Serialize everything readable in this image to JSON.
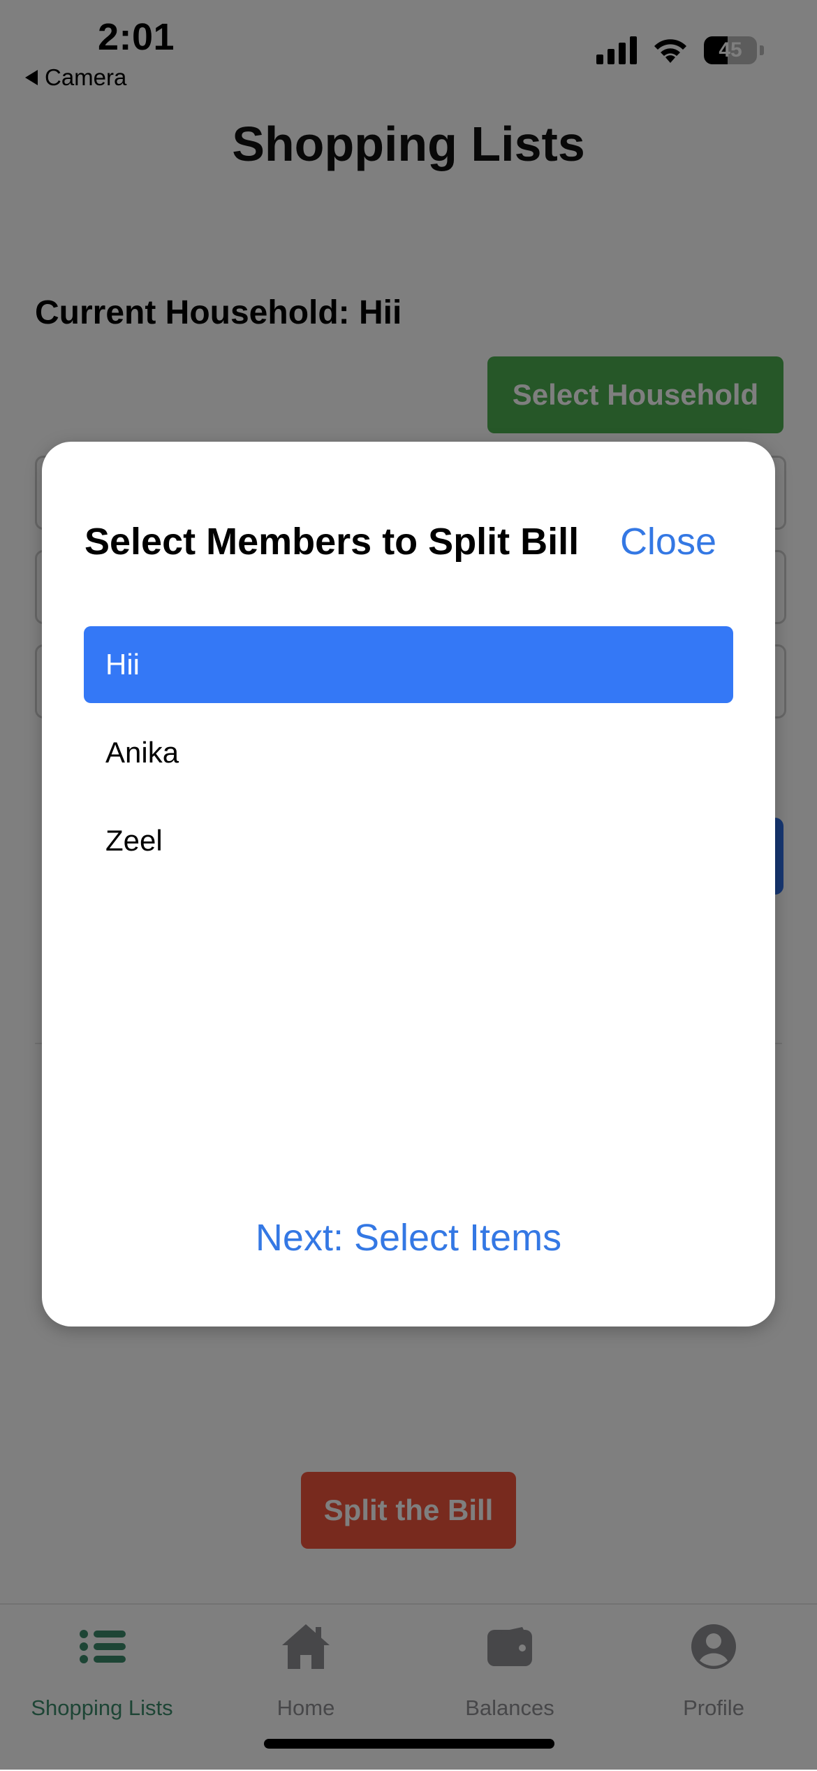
{
  "status_bar": {
    "time": "2:01",
    "back_label": "Camera",
    "battery": "45",
    "battery_level": 0.45
  },
  "page": {
    "title": "Shopping Lists",
    "current_household": "Current Household: Hii",
    "select_household_label": "Select Household",
    "split_bill_label": "Split the Bill"
  },
  "modal": {
    "title": "Select Members to Split Bill",
    "close_label": "Close",
    "members": [
      {
        "name": "Hii",
        "selected": true
      },
      {
        "name": "Anika",
        "selected": false
      },
      {
        "name": "Zeel",
        "selected": false
      }
    ],
    "next_label": "Next: Select Items"
  },
  "tab_bar": {
    "tabs": [
      {
        "label": "Shopping Lists",
        "icon": "list-icon",
        "active": true
      },
      {
        "label": "Home",
        "icon": "home-icon",
        "active": false
      },
      {
        "label": "Balances",
        "icon": "wallet-icon",
        "active": false
      },
      {
        "label": "Profile",
        "icon": "profile-icon",
        "active": false
      }
    ]
  },
  "colors": {
    "accent_blue": "#3478f6",
    "link_blue": "#3478e4",
    "green_button": "#4caf50",
    "red_button": "#f0553c",
    "active_tab": "#3a8a6a"
  }
}
